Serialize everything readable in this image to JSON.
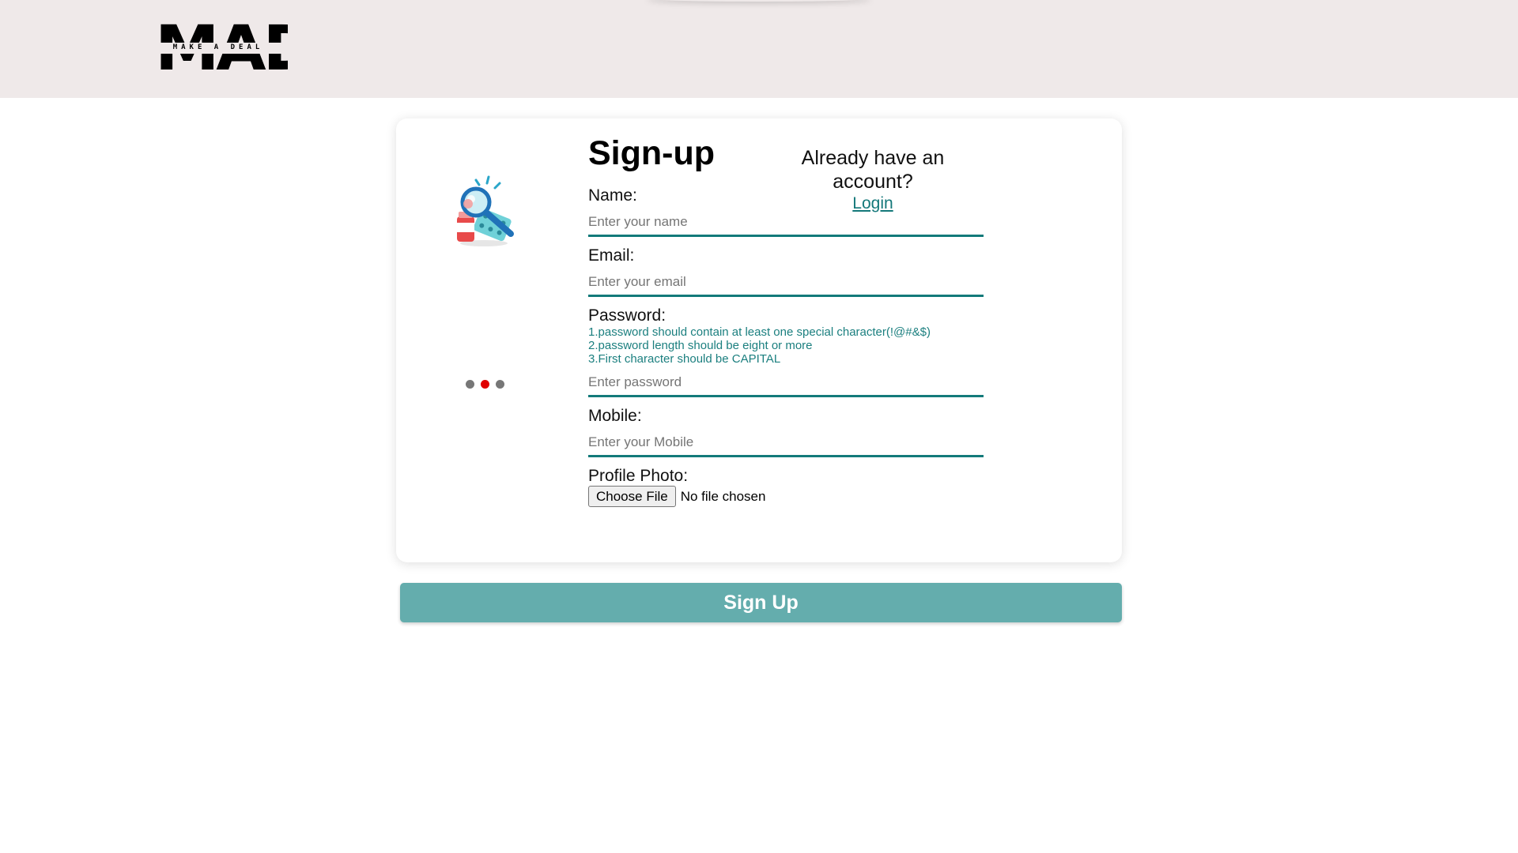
{
  "header": {
    "logo": {
      "text": "MAD",
      "tagline": "MAKE A DEAL",
      "icon": "mad-logo"
    },
    "background_color": "#efe9e9"
  },
  "signup_card": {
    "title": "Sign-up",
    "illustration_icon": "magnifier-with-pills-illustration",
    "carousel": {
      "dot_count": 3,
      "active_index": 1,
      "active_color": "#e00000",
      "inactive_color": "#777777"
    },
    "already_have_account": "Already have an account?",
    "login_link": "Login"
  },
  "form": {
    "name": {
      "label": "Name:",
      "placeholder": "Enter your name",
      "value": ""
    },
    "email": {
      "label": "Email:",
      "placeholder": "Enter your email",
      "value": ""
    },
    "password": {
      "label": "Password:",
      "placeholder": "Enter password",
      "value": "",
      "rules": [
        "1.password should contain at least one special character(!@#&$)",
        "2.password length should be eight or more",
        "3.First character should be CAPITAL"
      ]
    },
    "mobile": {
      "label": "Mobile:",
      "placeholder": "Enter your Mobile",
      "value": ""
    },
    "profile_photo": {
      "label": "Profile Photo:",
      "button_label": "Choose File",
      "status": "No file chosen"
    }
  },
  "submit": {
    "label": "Sign Up",
    "color": "#64adad"
  },
  "accent_color": "#137a7a"
}
